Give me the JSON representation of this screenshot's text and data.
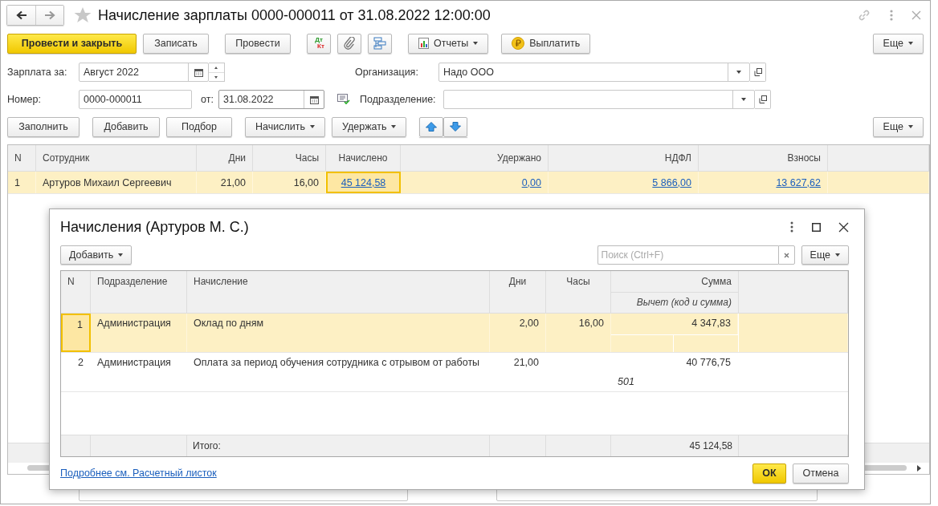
{
  "window": {
    "title": "Начисление зарплаты 0000-000011 от 31.08.2022 12:00:00"
  },
  "toolbar": {
    "post_close": "Провести и закрыть",
    "save": "Записать",
    "post": "Провести",
    "debit": "Дт",
    "credit": "Кт",
    "reports": "Отчеты",
    "pay": "Выплатить",
    "more": "Еще"
  },
  "form": {
    "salary_for": {
      "label": "Зарплата за:",
      "value": "Август 2022"
    },
    "number": {
      "label": "Номер:",
      "value": "0000-000011"
    },
    "date": {
      "label": "от:",
      "value": "31.08.2022"
    },
    "organization": {
      "label": "Организация:",
      "value": "Надо ООО"
    },
    "department": {
      "label": "Подразделение:"
    }
  },
  "table_toolbar": {
    "fill": "Заполнить",
    "add": "Добавить",
    "pick": "Подбор",
    "accrue": "Начислить",
    "withhold": "Удержать",
    "more": "Еще"
  },
  "table": {
    "columns": [
      {
        "label": "N",
        "kind": "text"
      },
      {
        "label": "Сотрудник",
        "kind": "text"
      },
      {
        "label": "Дни",
        "kind": "text"
      },
      {
        "label": "Часы",
        "kind": "text"
      },
      {
        "label": "Начислено",
        "kind": "link"
      },
      {
        "label": "Удержано",
        "kind": "link"
      },
      {
        "label": "НДФЛ",
        "kind": "link"
      },
      {
        "label": "Взносы",
        "kind": "link"
      }
    ],
    "rows": [
      {
        "selected": true,
        "cells": [
          {
            "text": "1",
            "focused": false
          },
          {
            "text": "Артуров Михаил Сергеевич",
            "focused": false
          },
          {
            "text": "21,00",
            "focused": false
          },
          {
            "text": "16,00",
            "focused": false
          },
          {
            "text": "45 124,58",
            "focused": true
          },
          {
            "text": "0,00",
            "focused": false
          },
          {
            "text": "5 866,00",
            "focused": false
          },
          {
            "text": "13 627,62",
            "focused": false
          }
        ]
      }
    ]
  },
  "dialog": {
    "title": "Начисления (Артуров М. С.)",
    "add": "Добавить",
    "search": {
      "placeholder": "Поиск (Ctrl+F)"
    },
    "more": "Еще",
    "columns": [
      "N",
      "Подразделение",
      "Начисление",
      "Дни",
      "Часы",
      "Сумма"
    ],
    "sub_header": "Вычет (код и сумма)",
    "rows": [
      {
        "selected": true,
        "n": "1",
        "department": "Администрация",
        "accrual": "Оклад по дням",
        "days": "2,00",
        "hours": "16,00",
        "sum": "4 347,83"
      },
      {
        "selected": false,
        "n": "2",
        "department": "Администрация",
        "accrual": "Оплата за период обучения сотрудника с отрывом от работы",
        "days": "21,00",
        "sum": "40 776,75",
        "deduction_code": "501"
      }
    ],
    "total_label": "Итого:",
    "total": "45 124,58",
    "link": "Подробнее см. Расчетный листок",
    "ok": "ОК",
    "cancel": "Отмена"
  }
}
